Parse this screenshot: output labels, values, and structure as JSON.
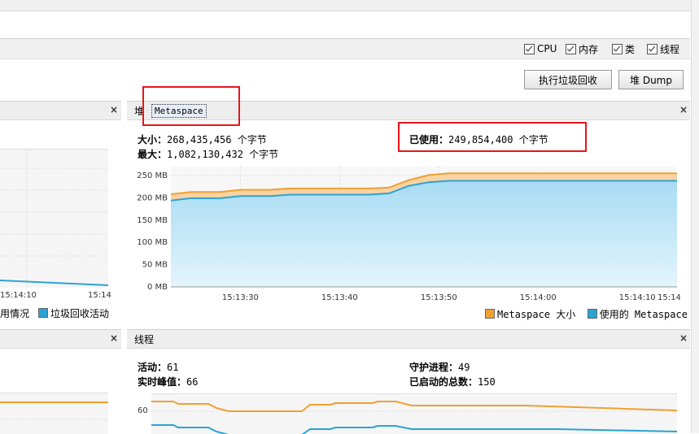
{
  "toolbar": {
    "checks": [
      {
        "label": "CPU",
        "checked": true
      },
      {
        "label": "内存",
        "checked": true
      },
      {
        "label": "类",
        "checked": true
      },
      {
        "label": "线程",
        "checked": true
      }
    ],
    "gc_button": "执行垃圾回收",
    "dump_button": "堆 Dump"
  },
  "left_top_panel": {
    "close": "×",
    "tick": "15:14:10",
    "tick_right": "15:14",
    "legend": {
      "item1": "用情况",
      "item2": "垃圾回收活动"
    }
  },
  "metaspace_panel": {
    "tab_heap": "堆",
    "tab_metaspace": "Metaspace",
    "close": "×",
    "size_label": "大小：",
    "size_value": "268,435,456",
    "size_unit": "个字节",
    "max_label": "最大：",
    "max_value": "1,082,130,432",
    "max_unit": "个字节",
    "used_label": "已使用：",
    "used_value": "249,854,400",
    "used_unit": "个字节",
    "legend": {
      "size": "Metaspace 大小",
      "used": "使用的 Metaspace"
    }
  },
  "threads_panel": {
    "title": "线程",
    "close": "×",
    "active_label": "活动：",
    "active_value": "61",
    "peak_label": "实时峰值：",
    "peak_value": "66",
    "daemon_label": "守护进程：",
    "daemon_value": "49",
    "started_label": "已启动的总数：",
    "started_value": "150",
    "ytick": "60"
  },
  "left_bottom_panel": {
    "close": "×"
  },
  "colors": {
    "size_series": "#f0a030",
    "used_series": "#2aa3d4",
    "highlight": "#e8141a"
  },
  "chart_data": {
    "type": "area",
    "x": [
      "15:13:23",
      "15:13:25",
      "15:13:28",
      "15:13:30",
      "15:13:33",
      "15:13:35",
      "15:13:38",
      "15:13:40",
      "15:13:43",
      "15:13:45",
      "15:13:47",
      "15:13:49",
      "15:13:51",
      "15:13:55",
      "15:14:00",
      "15:14:05",
      "15:14:10",
      "15:14:14"
    ],
    "series": [
      {
        "name": "Metaspace 大小",
        "values": [
          208,
          213,
          213,
          218,
          218,
          221,
          221,
          221,
          221,
          223,
          240,
          251,
          255,
          255,
          255,
          255,
          255,
          255
        ]
      },
      {
        "name": "使用的 Metaspace",
        "values": [
          194,
          199,
          199,
          204,
          204,
          207,
          207,
          207,
          207,
          210,
          227,
          235,
          238,
          238,
          238,
          238,
          238,
          238
        ]
      }
    ],
    "yticks": [
      "0 MB",
      "50 MB",
      "100 MB",
      "150 MB",
      "200 MB",
      "250 MB"
    ],
    "ylim": [
      0,
      270
    ],
    "xticks": [
      "15:13:30",
      "15:13:40",
      "15:13:50",
      "15:14:00",
      "15:14:10",
      "15:14"
    ],
    "grid": true,
    "legend_position": "bottom-right"
  }
}
